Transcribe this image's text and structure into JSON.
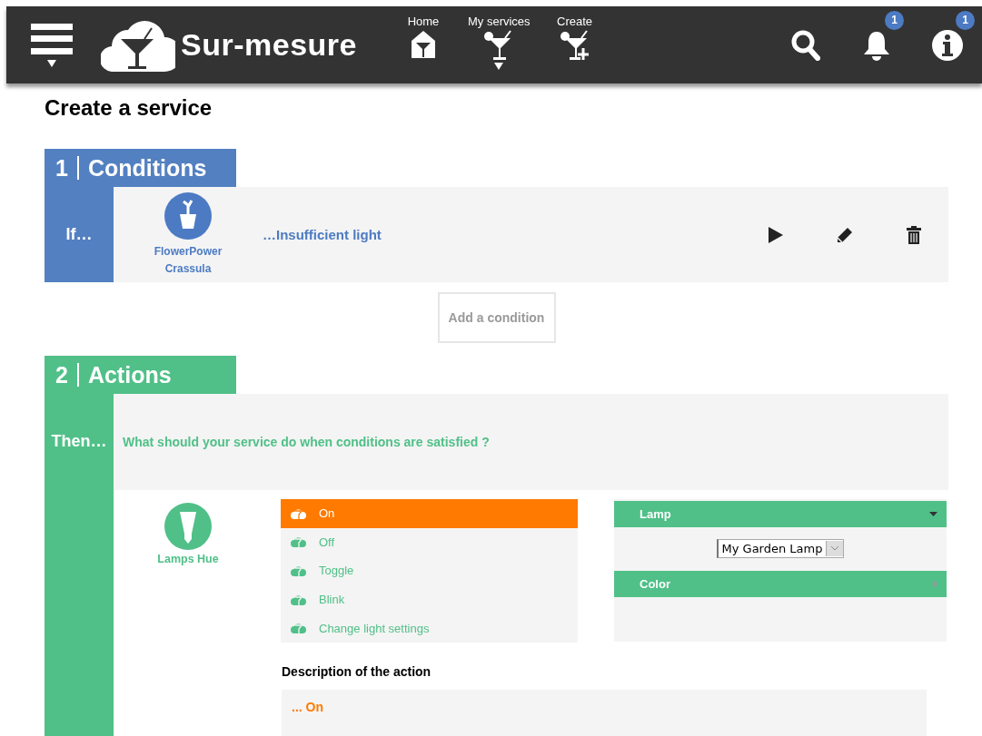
{
  "header": {
    "brand": "Sur-mesure",
    "nav": [
      {
        "label": "Home",
        "kind": "home",
        "has_menu": false
      },
      {
        "label": "My services",
        "kind": "services",
        "has_menu": true
      },
      {
        "label": "Create",
        "kind": "create",
        "has_menu": false
      }
    ],
    "notifications_badge": "1",
    "info_badge": "1"
  },
  "page_title": "Create a service",
  "conditions": {
    "number": "1",
    "title": "Conditions",
    "prefix": "If…",
    "device": {
      "name": "FlowerPower Crassula"
    },
    "condition": "…Insufficient light",
    "add_button": "Add a condition"
  },
  "actions": {
    "number": "2",
    "title": "Actions",
    "prefix": "Then…",
    "question": "What should your service do when conditions are satisfied ?",
    "device": {
      "name": "Lamps Hue"
    },
    "options": [
      {
        "label": "On",
        "selected": true
      },
      {
        "label": "Off",
        "selected": false
      },
      {
        "label": "Toggle",
        "selected": false
      },
      {
        "label": "Blink",
        "selected": false
      },
      {
        "label": "Change light settings",
        "selected": false
      }
    ],
    "settings": [
      {
        "title": "Lamp",
        "expanded": true,
        "value": "My Garden Lamp"
      },
      {
        "title": "Color",
        "expanded": false
      }
    ],
    "description_label": "Description of the action",
    "description": "... On"
  }
}
